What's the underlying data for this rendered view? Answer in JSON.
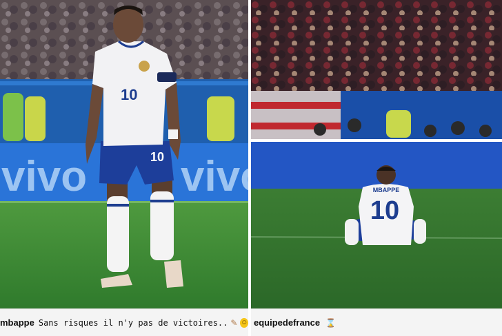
{
  "left": {
    "board_text": "vivo",
    "shirt_number": "10",
    "shorts_number": "10",
    "caption_user": "mbappe",
    "caption_text": "Sans risques il n'y pas de victoires..",
    "caption_emojis": [
      "flexed-biceps-icon",
      "grinning-face-icon"
    ]
  },
  "right": {
    "shirt_name": "MBAPPE",
    "shirt_number": "10",
    "caption_user": "equipedefrance",
    "caption_emojis": [
      "hourglass-icon"
    ]
  }
}
